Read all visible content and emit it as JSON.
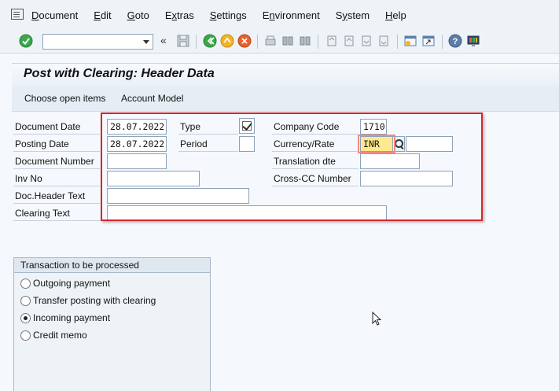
{
  "menu": {
    "items": [
      {
        "pre": "",
        "u": "D",
        "post": "ocument"
      },
      {
        "pre": "",
        "u": "E",
        "post": "dit"
      },
      {
        "pre": "",
        "u": "G",
        "post": "oto"
      },
      {
        "pre": "E",
        "u": "x",
        "post": "tras"
      },
      {
        "pre": "",
        "u": "S",
        "post": "ettings"
      },
      {
        "pre": "E",
        "u": "n",
        "post": "vironment"
      },
      {
        "pre": "S",
        "u": "y",
        "post": "stem"
      },
      {
        "pre": "",
        "u": "H",
        "post": "elp"
      }
    ]
  },
  "toolbar": {
    "command_value": "",
    "chevron": "«"
  },
  "title": "Post with Clearing: Header Data",
  "app_toolbar": {
    "choose_open_items": "Choose open items",
    "account_model": "Account Model"
  },
  "form": {
    "document_date_label": "Document Date",
    "document_date": "28.07.2022",
    "posting_date_label": "Posting Date",
    "posting_date": "28.07.2022",
    "document_number_label": "Document Number",
    "document_number": "",
    "inv_no_label": "Inv No",
    "inv_no": "",
    "doc_header_text_label": "Doc.Header Text",
    "doc_header_text": "",
    "clearing_text_label": "Clearing Text",
    "clearing_text": "",
    "type_label": "Type",
    "type_checked": true,
    "period_label": "Period",
    "period": "",
    "company_code_label": "Company Code",
    "company_code": "1710",
    "currency_rate_label": "Currency/Rate",
    "currency": "INR",
    "rate": "",
    "translation_dte_label": "Translation dte",
    "translation_dte": "",
    "cross_cc_number_label": "Cross-CC Number",
    "cross_cc_number": ""
  },
  "transaction_panel": {
    "title": "Transaction to be processed",
    "options": [
      {
        "label": "Outgoing payment",
        "selected": false
      },
      {
        "label": "Transfer posting with clearing",
        "selected": false
      },
      {
        "label": "Incoming payment",
        "selected": true
      },
      {
        "label": "Credit memo",
        "selected": false
      }
    ]
  },
  "colors": {
    "highlight_border": "#d8252b",
    "active_field": "#ffe98c",
    "background": "#f5f8fc"
  }
}
